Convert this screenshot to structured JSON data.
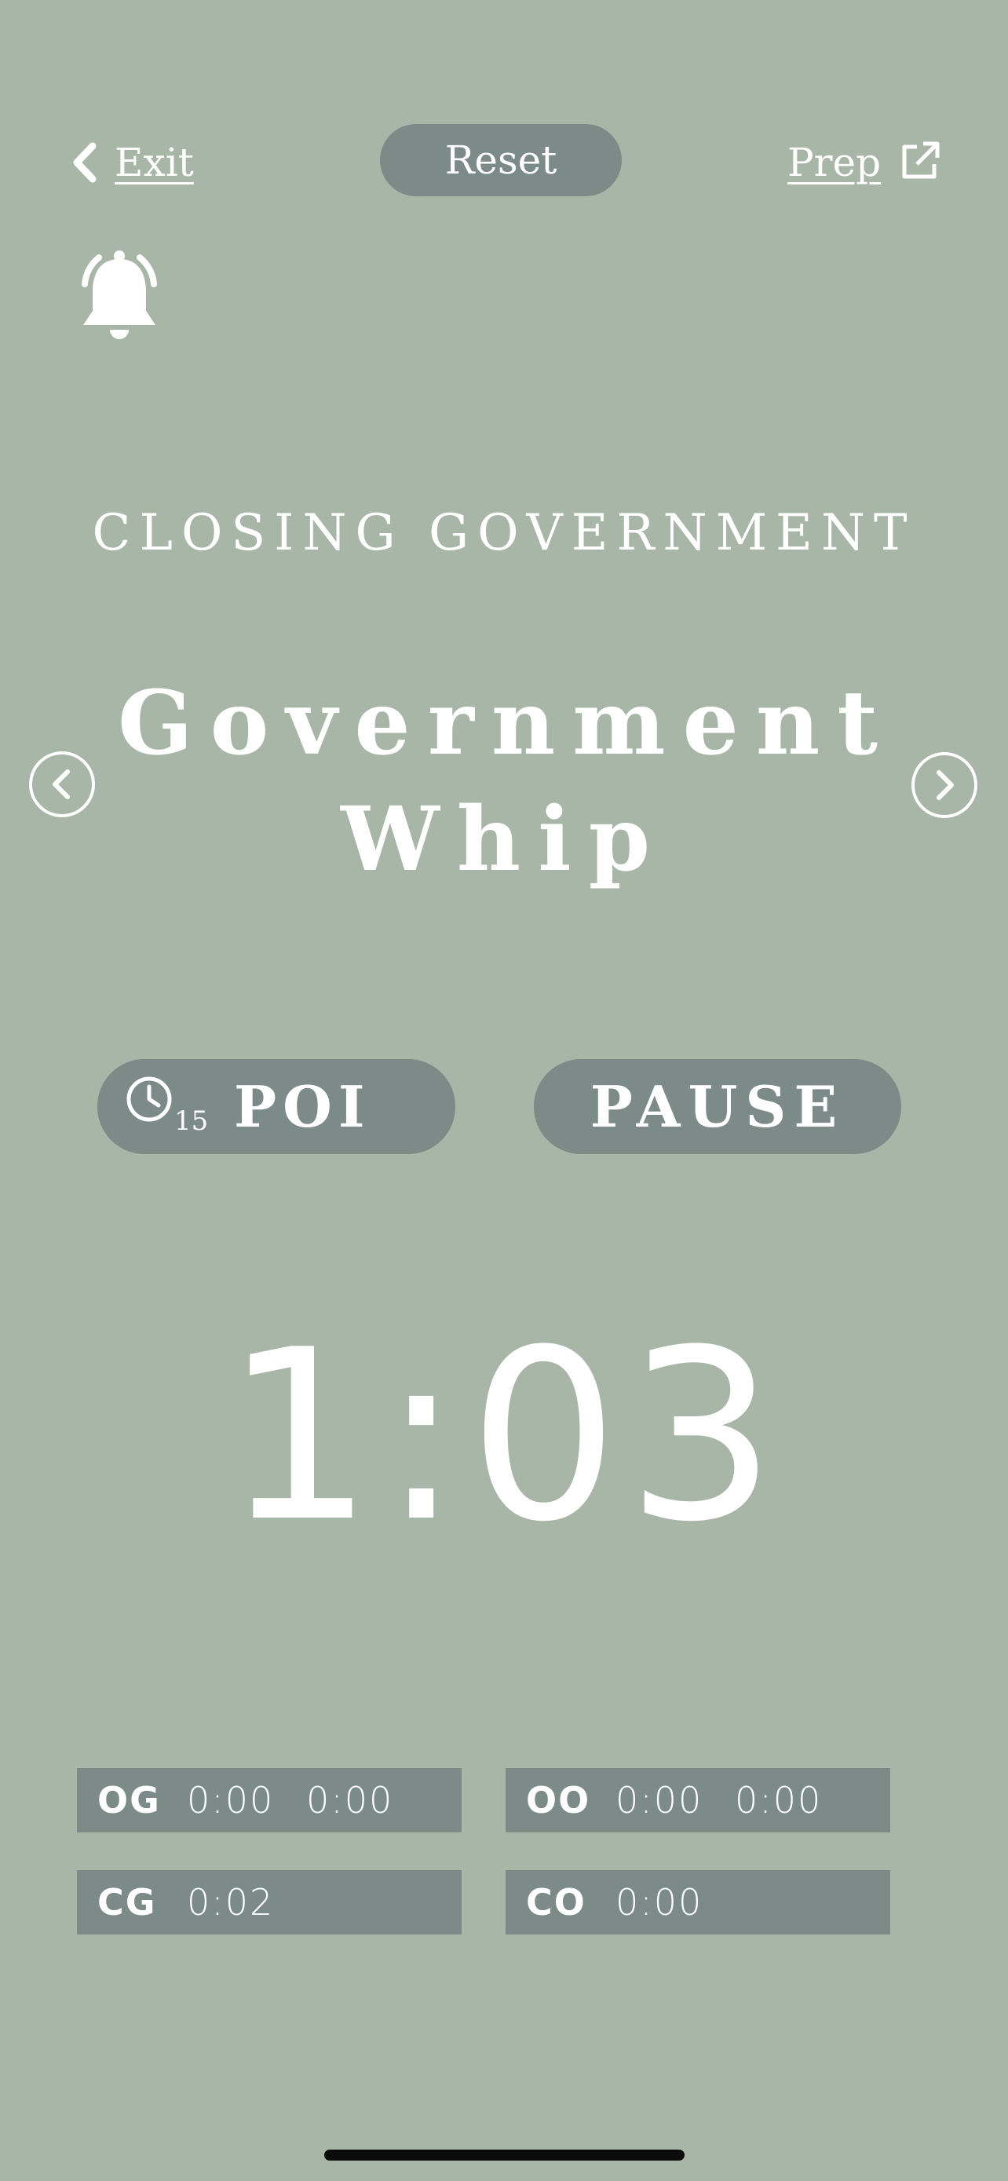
{
  "header": {
    "exit_label": "Exit",
    "reset_label": "Reset",
    "prep_label": "Prep"
  },
  "speaker": {
    "position": "CLOSING GOVERNMENT",
    "role_line1": "Government",
    "role_line2": "Whip"
  },
  "controls": {
    "poi_timer": "15",
    "poi_label": "POI",
    "pause_label": "PAUSE"
  },
  "timer": {
    "display": "1:03"
  },
  "team_times": {
    "og": {
      "label": "OG",
      "time1": "0:00",
      "time2": "0:00"
    },
    "oo": {
      "label": "OO",
      "time1": "0:00",
      "time2": "0:00"
    },
    "cg": {
      "label": "CG",
      "time1": "0:02"
    },
    "co": {
      "label": "CO",
      "time1": "0:00"
    }
  },
  "colors": {
    "background": "#a8b6a8",
    "button": "#7c8a88",
    "text": "#ffffff"
  },
  "icons": {
    "exit": "chevron-left-icon",
    "prep": "external-link-icon",
    "bell": "bell-ringing-icon",
    "prev": "chevron-left-circle-icon",
    "next": "chevron-right-circle-icon",
    "poi": "clock-icon"
  }
}
